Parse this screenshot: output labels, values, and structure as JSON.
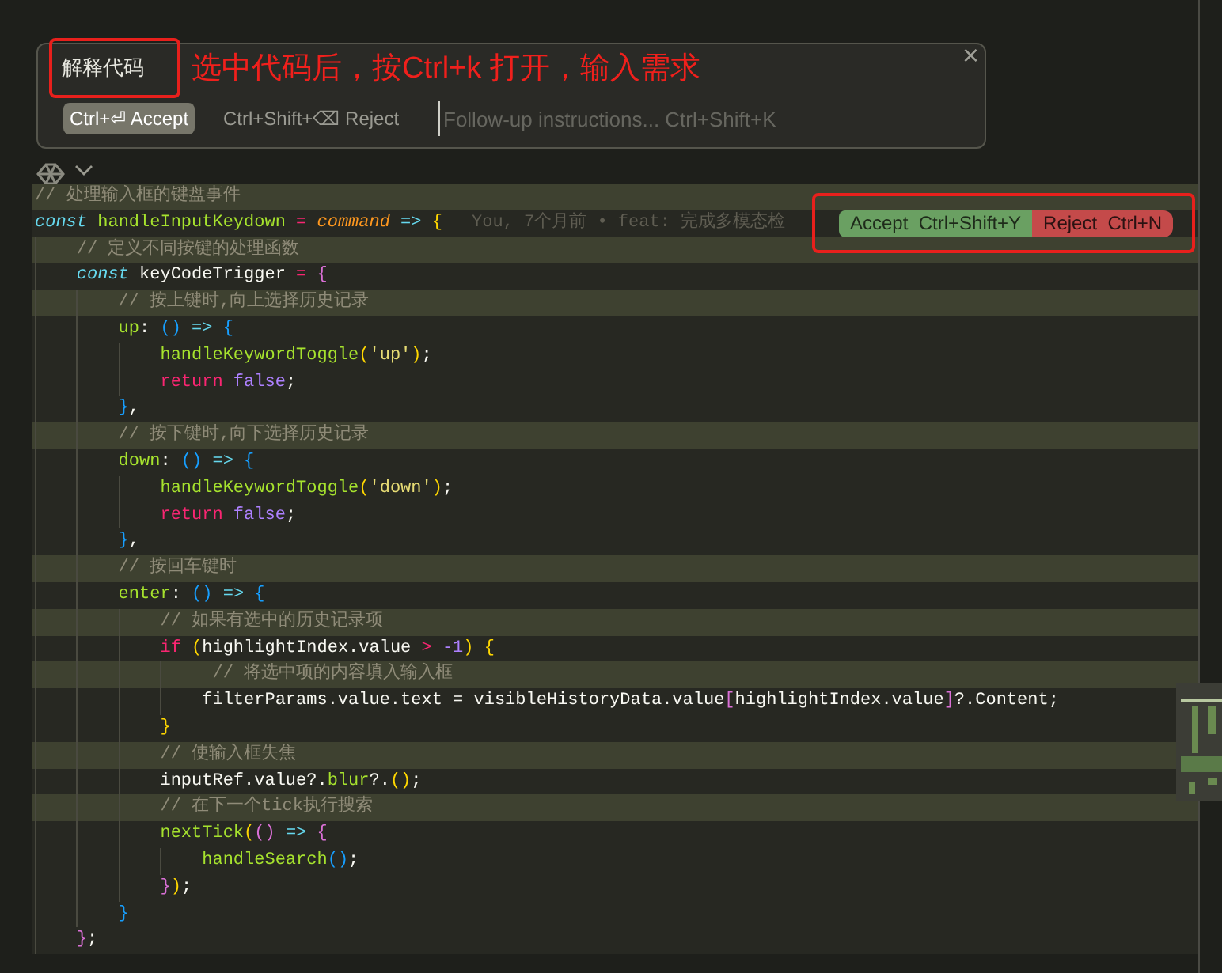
{
  "prompt_widget": {
    "title": "解释代码",
    "annotation": "选中代码后，按Ctrl+k 打开，输入需求",
    "close": "×",
    "accept_button": "Ctrl+⏎ Accept",
    "reject_button": "Ctrl+Shift+⌫ Reject",
    "followup_field": {
      "placeholder": "Follow-up instructions... Ctrl+Shift+K"
    }
  },
  "diff_actions": {
    "accept": "Accept  Ctrl+Shift+Y",
    "reject": "Reject  Ctrl+N"
  },
  "blame": "You, 7个月前 • feat: 完成多模态检",
  "lines": [
    {
      "highlighted": true,
      "tokens": [
        {
          "kind": "comment",
          "text": "// 处理输入框的键盘事件"
        }
      ]
    },
    {
      "highlighted": false,
      "tokens": [
        {
          "kind": "storage",
          "text": "const"
        },
        {
          "kind": "func",
          "text": " handleInputKeydown"
        },
        {
          "kind": "op",
          "text": " ="
        },
        {
          "kind": "param",
          "text": " command"
        },
        {
          "kind": "arrow",
          "text": " =>"
        },
        {
          "kind": "b1",
          "text": " {"
        }
      ]
    },
    {
      "highlighted": true,
      "tokens": [
        {
          "kind": "comment",
          "text": "    // 定义不同按键的处理函数"
        }
      ]
    },
    {
      "highlighted": false,
      "tokens": [
        {
          "kind": "storage",
          "text": "    const"
        },
        {
          "kind": "plain",
          "text": " keyCodeTrigger"
        },
        {
          "kind": "op",
          "text": " ="
        },
        {
          "kind": "b2",
          "text": " {"
        }
      ]
    },
    {
      "highlighted": true,
      "tokens": [
        {
          "kind": "comment",
          "text": "        // 按上键时,向上选择历史记录"
        }
      ]
    },
    {
      "highlighted": false,
      "tokens": [
        {
          "kind": "func",
          "text": "        up"
        },
        {
          "kind": "plain",
          "text": ":"
        },
        {
          "kind": "b3",
          "text": " ()"
        },
        {
          "kind": "arrow",
          "text": " =>"
        },
        {
          "kind": "b3",
          "text": " {"
        }
      ]
    },
    {
      "highlighted": false,
      "tokens": [
        {
          "kind": "func",
          "text": "            handleKeywordToggle"
        },
        {
          "kind": "b1",
          "text": "("
        },
        {
          "kind": "str",
          "text": "'up'"
        },
        {
          "kind": "b1",
          "text": ")"
        },
        {
          "kind": "plain",
          "text": ";"
        }
      ]
    },
    {
      "highlighted": false,
      "tokens": [
        {
          "kind": "kw",
          "text": "            return"
        },
        {
          "kind": "num",
          "text": " false"
        },
        {
          "kind": "plain",
          "text": ";"
        }
      ]
    },
    {
      "highlighted": false,
      "tokens": [
        {
          "kind": "b3",
          "text": "        }"
        },
        {
          "kind": "plain",
          "text": ","
        }
      ]
    },
    {
      "highlighted": true,
      "tokens": [
        {
          "kind": "comment",
          "text": "        // 按下键时,向下选择历史记录"
        }
      ]
    },
    {
      "highlighted": false,
      "tokens": [
        {
          "kind": "func",
          "text": "        down"
        },
        {
          "kind": "plain",
          "text": ":"
        },
        {
          "kind": "b3",
          "text": " ()"
        },
        {
          "kind": "arrow",
          "text": " =>"
        },
        {
          "kind": "b3",
          "text": " {"
        }
      ]
    },
    {
      "highlighted": false,
      "tokens": [
        {
          "kind": "func",
          "text": "            handleKeywordToggle"
        },
        {
          "kind": "b1",
          "text": "("
        },
        {
          "kind": "str",
          "text": "'down'"
        },
        {
          "kind": "b1",
          "text": ")"
        },
        {
          "kind": "plain",
          "text": ";"
        }
      ]
    },
    {
      "highlighted": false,
      "tokens": [
        {
          "kind": "kw",
          "text": "            return"
        },
        {
          "kind": "num",
          "text": " false"
        },
        {
          "kind": "plain",
          "text": ";"
        }
      ]
    },
    {
      "highlighted": false,
      "tokens": [
        {
          "kind": "b3",
          "text": "        }"
        },
        {
          "kind": "plain",
          "text": ","
        }
      ]
    },
    {
      "highlighted": true,
      "tokens": [
        {
          "kind": "comment",
          "text": "        // 按回车键时"
        }
      ]
    },
    {
      "highlighted": false,
      "tokens": [
        {
          "kind": "func",
          "text": "        enter"
        },
        {
          "kind": "plain",
          "text": ":"
        },
        {
          "kind": "b3",
          "text": " ()"
        },
        {
          "kind": "arrow",
          "text": " =>"
        },
        {
          "kind": "b3",
          "text": " {"
        }
      ]
    },
    {
      "highlighted": true,
      "tokens": [
        {
          "kind": "comment",
          "text": "            // 如果有选中的历史记录项"
        }
      ]
    },
    {
      "highlighted": false,
      "tokens": [
        {
          "kind": "kw",
          "text": "            if"
        },
        {
          "kind": "b1",
          "text": " ("
        },
        {
          "kind": "plain",
          "text": "highlightIndex.value"
        },
        {
          "kind": "op",
          "text": " >"
        },
        {
          "kind": "num",
          "text": " -1"
        },
        {
          "kind": "b1",
          "text": ")"
        },
        {
          "kind": "b1",
          "text": " {"
        }
      ]
    },
    {
      "highlighted": true,
      "tokens": [
        {
          "kind": "comment",
          "text": "                 // 将选中项的内容填入输入框"
        }
      ]
    },
    {
      "highlighted": false,
      "tokens": [
        {
          "kind": "plain",
          "text": "                filterParams.value.text = visibleHistoryData.value"
        },
        {
          "kind": "b2",
          "text": "["
        },
        {
          "kind": "plain",
          "text": "highlightIndex.value"
        },
        {
          "kind": "b2",
          "text": "]"
        },
        {
          "kind": "plain",
          "text": "?.Content;"
        }
      ]
    },
    {
      "highlighted": false,
      "tokens": [
        {
          "kind": "b1",
          "text": "            }"
        }
      ]
    },
    {
      "highlighted": true,
      "tokens": [
        {
          "kind": "comment",
          "text": "            // 使输入框失焦"
        }
      ]
    },
    {
      "highlighted": false,
      "tokens": [
        {
          "kind": "plain",
          "text": "            inputRef.value?."
        },
        {
          "kind": "func",
          "text": "blur"
        },
        {
          "kind": "plain",
          "text": "?."
        },
        {
          "kind": "b1",
          "text": "()"
        },
        {
          "kind": "plain",
          "text": ";"
        }
      ]
    },
    {
      "highlighted": true,
      "tokens": [
        {
          "kind": "comment",
          "text": "            // 在下一个tick执行搜索"
        }
      ]
    },
    {
      "highlighted": false,
      "tokens": [
        {
          "kind": "func",
          "text": "            nextTick"
        },
        {
          "kind": "b1",
          "text": "("
        },
        {
          "kind": "b2",
          "text": "()"
        },
        {
          "kind": "arrow",
          "text": " =>"
        },
        {
          "kind": "b2",
          "text": " {"
        }
      ]
    },
    {
      "highlighted": false,
      "tokens": [
        {
          "kind": "func",
          "text": "                handleSearch"
        },
        {
          "kind": "b3",
          "text": "()"
        },
        {
          "kind": "plain",
          "text": ";"
        }
      ]
    },
    {
      "highlighted": false,
      "tokens": [
        {
          "kind": "b2",
          "text": "            }"
        },
        {
          "kind": "b1",
          "text": ")"
        },
        {
          "kind": "plain",
          "text": ";"
        }
      ]
    },
    {
      "highlighted": false,
      "tokens": [
        {
          "kind": "b3",
          "text": "        }"
        }
      ]
    },
    {
      "highlighted": false,
      "tokens": [
        {
          "kind": "b2",
          "text": "    }"
        },
        {
          "kind": "plain",
          "text": ";"
        }
      ]
    }
  ]
}
